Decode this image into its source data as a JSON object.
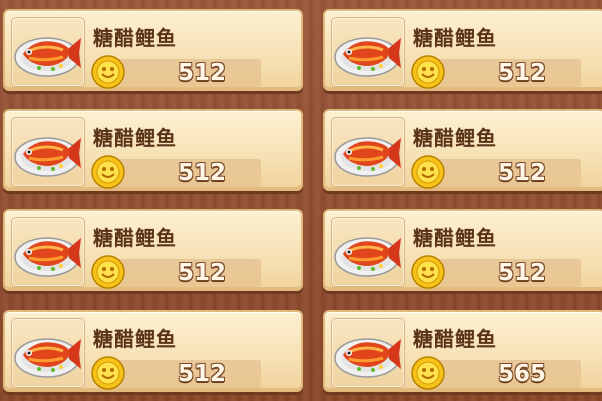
{
  "items": [
    {
      "name": "糖醋鲤鱼",
      "price": "512",
      "icon": "sweet-sour-carp-icon"
    },
    {
      "name": "糖醋鲤鱼",
      "price": "512",
      "icon": "sweet-sour-carp-icon"
    },
    {
      "name": "糖醋鲤鱼",
      "price": "512",
      "icon": "sweet-sour-carp-icon"
    },
    {
      "name": "糖醋鲤鱼",
      "price": "512",
      "icon": "sweet-sour-carp-icon"
    },
    {
      "name": "糖醋鲤鱼",
      "price": "512",
      "icon": "sweet-sour-carp-icon"
    },
    {
      "name": "糖醋鲤鱼",
      "price": "512",
      "icon": "sweet-sour-carp-icon"
    },
    {
      "name": "糖醋鲤鱼",
      "price": "512",
      "icon": "sweet-sour-carp-icon"
    },
    {
      "name": "糖醋鲤鱼",
      "price": "565",
      "icon": "sweet-sour-carp-icon"
    }
  ],
  "currency_icon": "gold-coin-icon",
  "colors": {
    "frame": "#8e4a2d",
    "card": "#f7e2b6",
    "name_text": "#5b3418",
    "price_text": "#fff6e6",
    "coin": "#f5c518"
  }
}
